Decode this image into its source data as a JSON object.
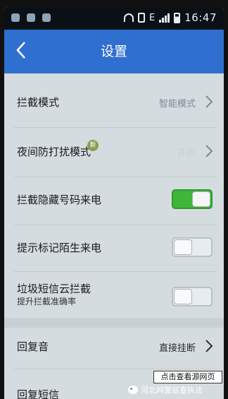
{
  "status_bar": {
    "time": "16:47",
    "network": "E"
  },
  "header": {
    "title": "设置"
  },
  "settings": {
    "intercept_mode": {
      "label": "拦截模式",
      "value": "智能模式"
    },
    "night_dnd": {
      "label": "夜间防打扰模式",
      "value": "开启",
      "badge": "新"
    },
    "hidden_number": {
      "label": "拦截隐藏号码来电",
      "enabled": true
    },
    "mark_stranger": {
      "label": "提示标记陌生来电",
      "enabled": false
    },
    "spam_sms": {
      "label": "垃圾短信云拦截",
      "sublabel": "提升拦截准确率",
      "enabled": false
    },
    "reply_tone": {
      "label": "回复音",
      "value": "直接挂断"
    },
    "reply_sms": {
      "label": "回复短信"
    }
  },
  "watermark": {
    "box_text": "点击查看源网页",
    "account": "河北网警巡查执法"
  },
  "colors": {
    "header_blue": "#2f6fd0",
    "toggle_on": "#3fb53a",
    "background": "#d5dce0"
  }
}
